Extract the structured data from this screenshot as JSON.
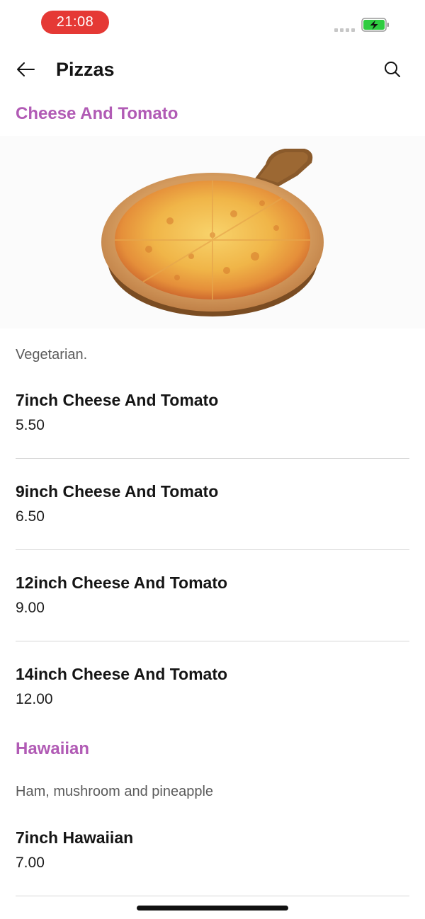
{
  "status_bar": {
    "time": "21:08",
    "time_pill_color": "#e53935",
    "battery_color": "#2ecc40",
    "battery_state": "charging"
  },
  "header": {
    "title": "Pizzas",
    "back_icon": "arrow-left-icon",
    "search_icon": "search-icon"
  },
  "theme": {
    "accent": "#b15bb5"
  },
  "categories": [
    {
      "title": "Cheese And Tomato",
      "image": "pizza-image",
      "description": "Vegetarian.",
      "items": [
        {
          "name": "7inch Cheese And Tomato",
          "price": "5.50"
        },
        {
          "name": "9inch Cheese And Tomato",
          "price": "6.50"
        },
        {
          "name": "12inch Cheese And Tomato",
          "price": "9.00"
        },
        {
          "name": "14inch Cheese And Tomato",
          "price": "12.00"
        }
      ]
    },
    {
      "title": "Hawaiian",
      "description": "Ham, mushroom and pineapple",
      "items": [
        {
          "name": "7inch Hawaiian",
          "price": "7.00"
        }
      ]
    }
  ]
}
